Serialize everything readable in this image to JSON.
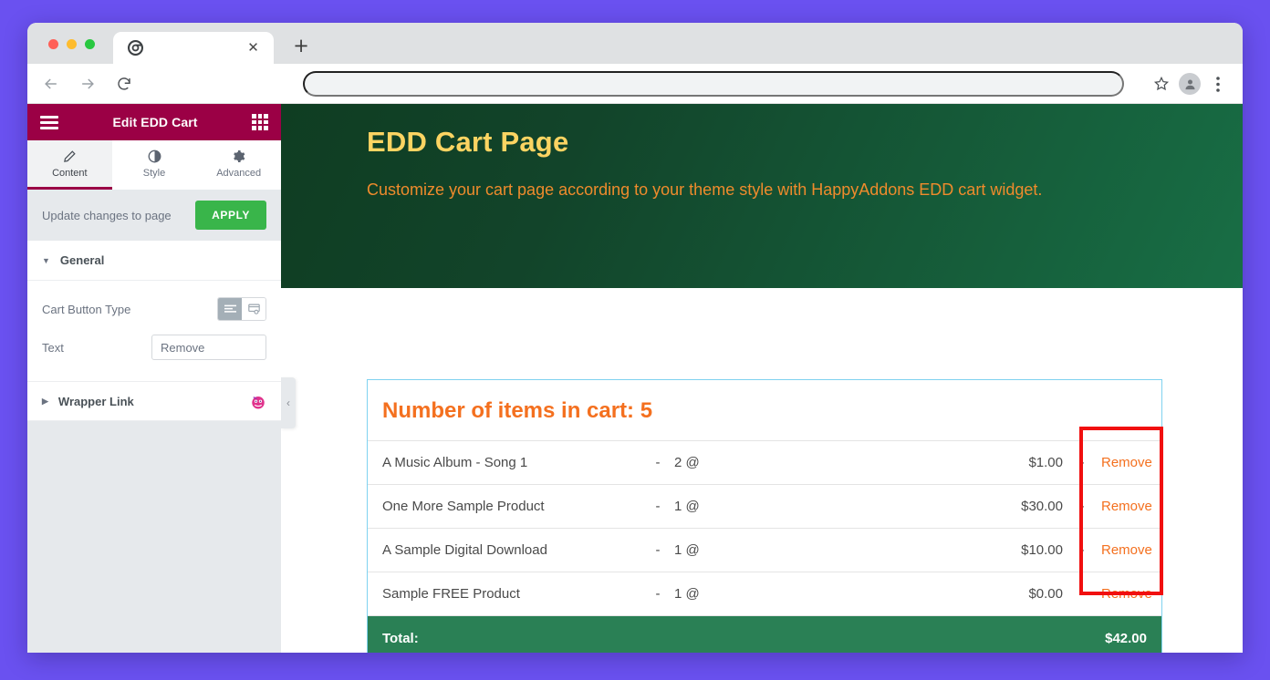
{
  "browser": {
    "tab": {
      "favicon_icon": "chrome-icon",
      "title": "",
      "close_icon": "close-icon"
    },
    "new_tab_label": "+",
    "back_icon": "back-arrow-icon",
    "forward_icon": "forward-arrow-icon",
    "reload_icon": "reload-icon",
    "address_value": "",
    "address_placeholder": "",
    "star_icon": "bookmark-star-icon",
    "profile_icon": "profile-avatar-icon",
    "menu_icon": "kebab-menu-icon"
  },
  "panel": {
    "header": {
      "menu_icon": "hamburger-icon",
      "title": "Edit EDD Cart",
      "grid_icon": "widgets-grid-icon",
      "bg_color": "#9b0045"
    },
    "tabs": [
      {
        "label": "Content",
        "icon": "pencil-icon",
        "active": true
      },
      {
        "label": "Style",
        "icon": "contrast-circle-icon",
        "active": false
      },
      {
        "label": "Advanced",
        "icon": "gear-icon",
        "active": false
      }
    ],
    "apply": {
      "text": "Update changes to page",
      "button_label": "APPLY",
      "button_color": "#39b54a"
    },
    "sections": [
      {
        "title": "General",
        "expanded": true
      },
      {
        "title": "Wrapper Link",
        "expanded": false,
        "badge_icon": "happyaddons-icon"
      }
    ],
    "controls": {
      "cart_button_type": {
        "label": "Cart Button Type",
        "options": [
          {
            "icon": "text-align-icon",
            "selected": true
          },
          {
            "icon": "button-box-icon",
            "selected": false
          }
        ]
      },
      "text": {
        "label": "Text",
        "value": "Remove",
        "placeholder": "Remove"
      }
    },
    "collapse_icon": "chevron-left-icon"
  },
  "site": {
    "hero": {
      "title": "EDD Cart Page",
      "subtitle": "Customize your cart page according to your theme style with HappyAddons EDD cart widget.",
      "title_color": "#fcd462",
      "subtitle_color": "#ef8b2c"
    },
    "cart": {
      "heading": "Number of items in cart: 5",
      "heading_color": "#f4701f",
      "separator": "-",
      "rows": [
        {
          "name": "A Music Album - Song 1",
          "dash1": "-",
          "qty": "2 @",
          "price": "$1.00",
          "dash2": "-",
          "remove": "Remove"
        },
        {
          "name": "One More Sample Product",
          "dash1": "-",
          "qty": "1 @",
          "price": "$30.00",
          "dash2": "-",
          "remove": "Remove"
        },
        {
          "name": "A Sample Digital Download",
          "dash1": "-",
          "qty": "1 @",
          "price": "$10.00",
          "dash2": "-",
          "remove": "Remove"
        },
        {
          "name": "Sample FREE Product",
          "dash1": "-",
          "qty": "1 @",
          "price": "$0.00",
          "dash2": "-",
          "remove": "Remove"
        }
      ],
      "total": {
        "label": "Total:",
        "value": "$42.00",
        "bg_color": "#2a8055"
      },
      "border_color": "#7fd2f0"
    }
  },
  "annotation": {
    "highlight_color": "#f10f0f"
  }
}
